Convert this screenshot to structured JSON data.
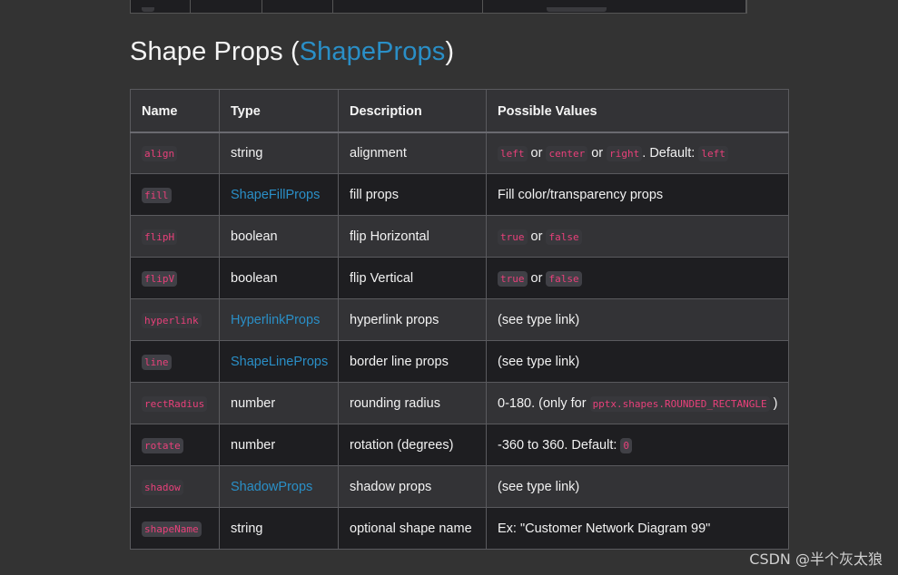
{
  "heading": {
    "title": "Shape Props",
    "open_paren": " (",
    "link": "ShapeProps",
    "close_paren": ")"
  },
  "table": {
    "headers": [
      "Name",
      "Type",
      "Description",
      "Possible Values"
    ],
    "rows": [
      {
        "name": "align",
        "type": "string",
        "type_is_link": false,
        "description": "alignment",
        "values": [
          {
            "kind": "code",
            "text": "left"
          },
          {
            "kind": "text",
            "text": " or "
          },
          {
            "kind": "code",
            "text": "center"
          },
          {
            "kind": "text",
            "text": " or "
          },
          {
            "kind": "code",
            "text": "right"
          },
          {
            "kind": "text",
            "text": ". Default: "
          },
          {
            "kind": "code",
            "text": "left"
          }
        ]
      },
      {
        "name": "fill",
        "type": "ShapeFillProps",
        "type_is_link": true,
        "description": "fill props",
        "values": [
          {
            "kind": "text",
            "text": "Fill color/transparency props"
          }
        ]
      },
      {
        "name": "flipH",
        "type": "boolean",
        "type_is_link": false,
        "description": "flip Horizontal",
        "values": [
          {
            "kind": "code",
            "text": "true"
          },
          {
            "kind": "text",
            "text": " or "
          },
          {
            "kind": "code",
            "text": "false"
          }
        ]
      },
      {
        "name": "flipV",
        "type": "boolean",
        "type_is_link": false,
        "description": "flip Vertical",
        "values": [
          {
            "kind": "code",
            "text": "true"
          },
          {
            "kind": "text",
            "text": " or "
          },
          {
            "kind": "code",
            "text": "false"
          }
        ]
      },
      {
        "name": "hyperlink",
        "type": "HyperlinkProps",
        "type_is_link": true,
        "description": "hyperlink props",
        "values": [
          {
            "kind": "text",
            "text": "(see type link)"
          }
        ]
      },
      {
        "name": "line",
        "type": "ShapeLineProps",
        "type_is_link": true,
        "description": "border line props",
        "values": [
          {
            "kind": "text",
            "text": "(see type link)"
          }
        ]
      },
      {
        "name": "rectRadius",
        "type": "number",
        "type_is_link": false,
        "description": "rounding radius",
        "values": [
          {
            "kind": "text",
            "text": "0-180. (only for "
          },
          {
            "kind": "code",
            "text": "pptx.shapes.ROUNDED_RECTANGLE"
          },
          {
            "kind": "text",
            "text": " )"
          }
        ]
      },
      {
        "name": "rotate",
        "type": "number",
        "type_is_link": false,
        "description": "rotation (degrees)",
        "values": [
          {
            "kind": "text",
            "text": "-360 to 360. Default: "
          },
          {
            "kind": "code",
            "text": "0"
          }
        ]
      },
      {
        "name": "shadow",
        "type": "ShadowProps",
        "type_is_link": true,
        "description": "shadow props",
        "values": [
          {
            "kind": "text",
            "text": "(see type link)"
          }
        ]
      },
      {
        "name": "shapeName",
        "type": "string",
        "type_is_link": false,
        "description": "optional shape name",
        "values": [
          {
            "kind": "text",
            "text": "Ex: \"Customer Network Diagram 99\""
          }
        ]
      }
    ]
  },
  "watermark": "CSDN @半个灰太狼",
  "colors": {
    "background": "#333333",
    "link": "#2a8fc7",
    "code_text": "#e8407a",
    "row_dark": "#1e1e21",
    "row_light": "#333336"
  }
}
